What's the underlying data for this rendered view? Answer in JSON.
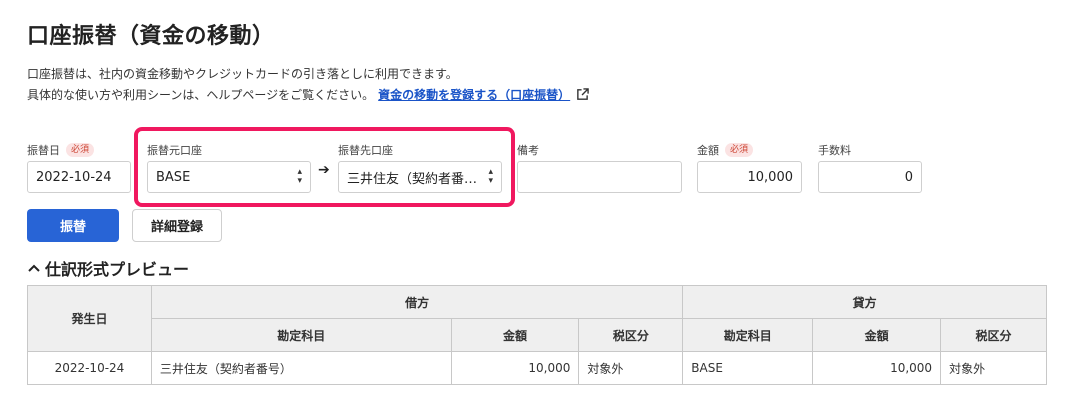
{
  "page_title": "口座振替（資金の移動）",
  "description": {
    "line1": "口座振替は、社内の資金移動やクレジットカードの引き落としに利用できます。",
    "line2": "具体的な使い方や利用シーンは、ヘルプページをご覧ください。",
    "help_link": "資金の移動を登録する（口座振替）",
    "link_icon": "external-link-icon"
  },
  "form": {
    "date_label": "振替日",
    "required_badge": "必須",
    "date_value": "2022-10-24",
    "from_label": "振替元口座",
    "from_value": "BASE",
    "to_label": "振替先口座",
    "to_value": "三井住友（契約者番…",
    "memo_label": "備考",
    "memo_value": "",
    "amount_label": "金額",
    "amount_value": "10,000",
    "fee_label": "手数料",
    "fee_value": "0",
    "arrow": "➔"
  },
  "buttons": {
    "transfer": "振替",
    "detail": "詳細登録"
  },
  "preview": {
    "title": "仕訳形式プレビュー",
    "headers": {
      "date": "発生日",
      "debit": "借方",
      "credit": "貸方",
      "account": "勘定科目",
      "amount": "金額",
      "tax": "税区分"
    },
    "rows": [
      {
        "date": "2022-10-24",
        "debit_account": "三井住友（契約者番号）",
        "debit_amount": "10,000",
        "debit_tax": "対象外",
        "credit_account": "BASE",
        "credit_amount": "10,000",
        "credit_tax": "対象外"
      }
    ]
  },
  "colors": {
    "primary": "#2864d6",
    "highlight": "#f0185f",
    "link": "#1a54c8"
  }
}
